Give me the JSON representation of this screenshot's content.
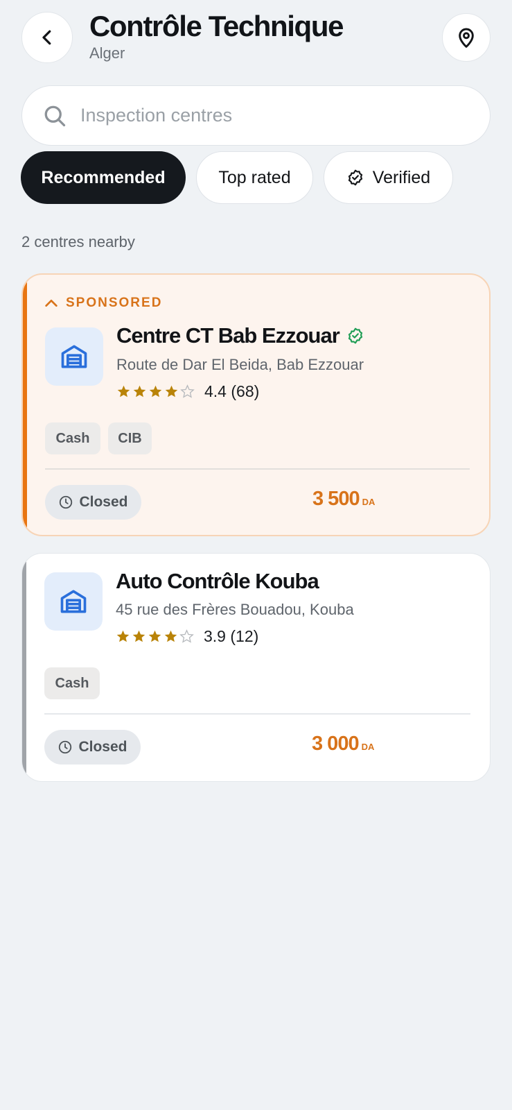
{
  "header": {
    "title": "Contrôle Technique",
    "subtitle": "Alger",
    "back_icon": "chevron-left-icon",
    "location_icon": "map-pin-icon"
  },
  "search": {
    "placeholder": "Inspection centres",
    "value": "",
    "icon": "search-icon"
  },
  "filters": [
    {
      "label": "Recommended",
      "selected": true
    },
    {
      "label": "Top rated",
      "selected": false
    },
    {
      "label": "Verified",
      "selected": false,
      "icon": "check-badge-icon"
    }
  ],
  "results_count": "2 centres nearby",
  "centres": [
    {
      "sponsored_label": "SPONSORED",
      "name": "Centre CT Bab Ezzouar",
      "verified": true,
      "address": "Route de Dar El Beida, Bab Ezzouar",
      "rating": 4.4,
      "rating_text": "4.4 (68)",
      "payment_tags": [
        "Cash",
        "CIB"
      ],
      "status": "Closed",
      "price": "3 500",
      "currency": "DA",
      "accent_color": "#e87511"
    },
    {
      "name": "Auto Contrôle Kouba",
      "verified": false,
      "address": "45 rue des Frères Bouadou, Kouba",
      "rating": 3.9,
      "rating_text": "3.9 (12)",
      "payment_tags": [
        "Cash"
      ],
      "status": "Closed",
      "price": "3 000",
      "currency": "DA",
      "accent_color": "#a0a4a9"
    }
  ],
  "colors": {
    "accent_orange": "#d8731a",
    "dark_chip": "#15191e",
    "star": "#b98308",
    "verified_green": "#1f9d55",
    "logo_blue": "#2a6fdb"
  }
}
